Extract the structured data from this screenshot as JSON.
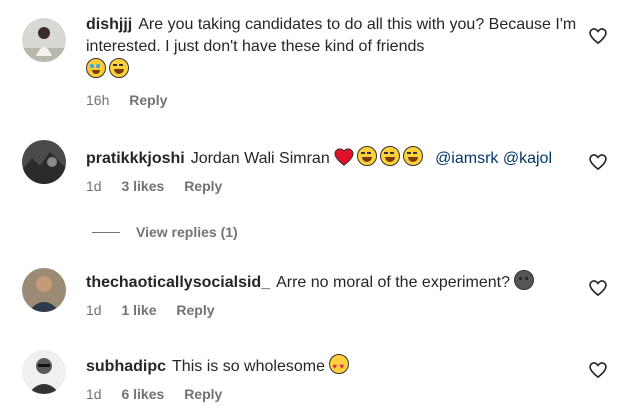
{
  "comments": [
    {
      "username": "dishjjj",
      "text": "Are you taking candidates to do all this with you? Because I'm interested. I just don't have these kind of friends",
      "emojis": [
        "crying-face",
        "laughing-face"
      ],
      "time": "16h",
      "likes": "",
      "reply_label": "Reply"
    },
    {
      "username": "pratikkkjoshi",
      "text": "Jordan Wali Simran",
      "emojis": [
        "red-heart",
        "laughing-face",
        "laughing-face",
        "laughing-face"
      ],
      "mentions": "@iamsrk @kajol",
      "time": "1d",
      "likes": "3 likes",
      "reply_label": "Reply"
    },
    {
      "username": "thechaoticallysocialsid_",
      "text": "Arre no moral of the experiment?",
      "emojis": [
        "neutral-face"
      ],
      "time": "1d",
      "likes": "1 like",
      "reply_label": "Reply"
    },
    {
      "username": "subhadipc",
      "text": "This is so wholesome",
      "emojis": [
        "heart-eyes-face"
      ],
      "time": "1d",
      "likes": "6 likes",
      "reply_label": "Reply"
    }
  ],
  "view_replies_label": "View replies (1)",
  "colors": {
    "muted": "#737373",
    "text": "#262626",
    "mention": "#00376b"
  }
}
